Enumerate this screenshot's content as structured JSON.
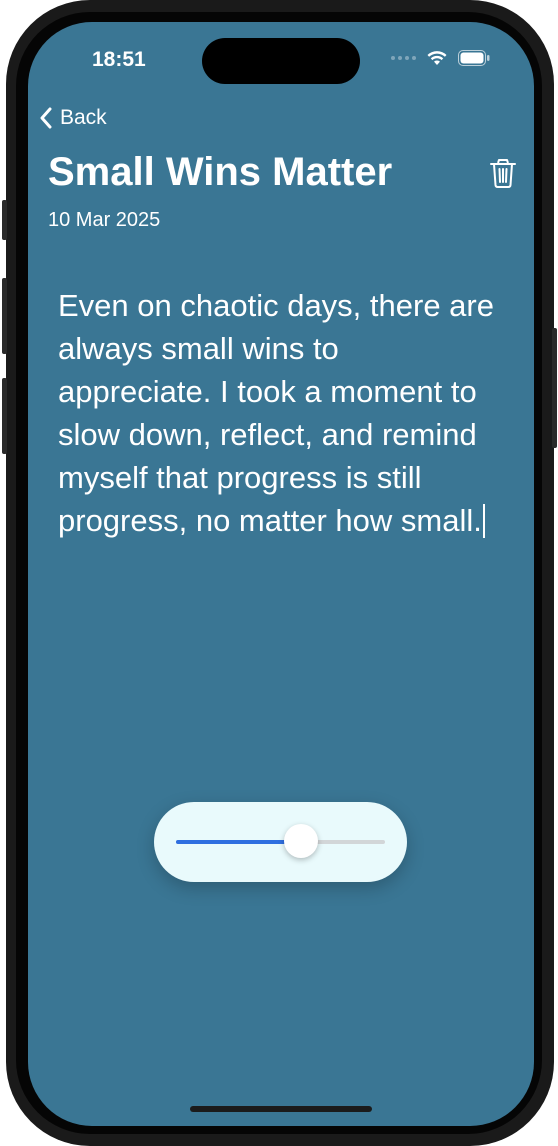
{
  "status_bar": {
    "time": "18:51",
    "icons": [
      "signal-icon",
      "wifi-icon",
      "battery-icon"
    ]
  },
  "nav": {
    "back_label": "Back",
    "back_icon": "chevron-left-icon",
    "delete_icon": "trash-icon"
  },
  "note": {
    "title": "Small Wins Matter",
    "date": "10 Mar 2025",
    "body": "Even on chaotic days, there are always small wins to appreciate. I took a moment to slow down, reflect, and remind myself that progress is still progress, no matter how small."
  },
  "slider": {
    "value": 0.6
  },
  "colors": {
    "background": "#3a7694",
    "text": "#ffffff",
    "slider_accent": "#2f6fe0",
    "slider_pill": "#e9fafc"
  }
}
